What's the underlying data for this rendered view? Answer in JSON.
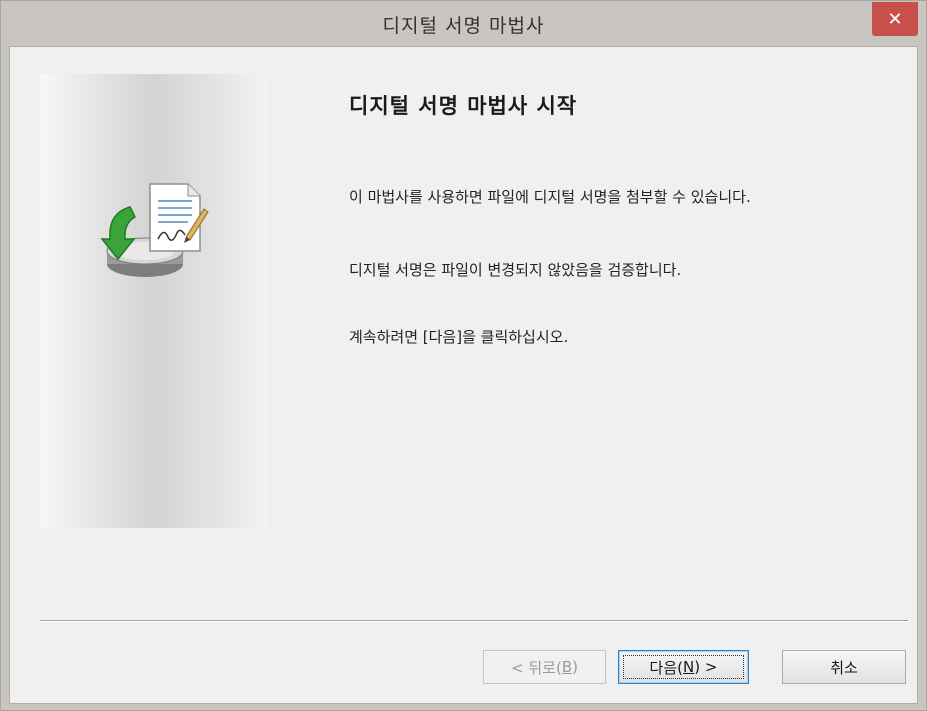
{
  "window": {
    "title": "디지털 서명 마법사",
    "close_glyph": "✕"
  },
  "content": {
    "heading": "디지털 서명 마법사 시작",
    "paragraph1": "이 마법사를 사용하면 파일에 디지털 서명을 첨부할 수 있습니다.",
    "paragraph2": "디지털 서명은 파일이 변경되지 않았음을 검증합니다.",
    "paragraph3": "계속하려면 [다음]을 클릭하십시오."
  },
  "buttons": {
    "back": {
      "prefix": "< 뒤로(",
      "mnemonic": "B",
      "suffix": ")",
      "enabled": false
    },
    "next": {
      "prefix": "다음(",
      "mnemonic": "N",
      "suffix": ") >",
      "enabled": true
    },
    "cancel": {
      "label": "취소",
      "enabled": true
    }
  },
  "icons": {
    "wizard": "digital-signature-document-icon"
  },
  "colors": {
    "close_button": "#c7504a",
    "titlebar": "#c9c5c1",
    "dialog_background": "#f0f0f0",
    "arrow_green": "#3aa33a"
  }
}
